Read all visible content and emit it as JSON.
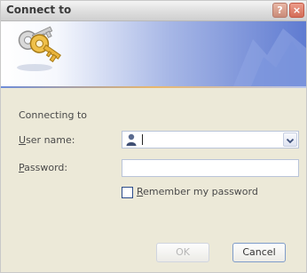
{
  "window": {
    "title": "Connect to",
    "help_label": "?",
    "close_label": "×"
  },
  "banner": {
    "icon": "keys-icon"
  },
  "form": {
    "connecting_label": "Connecting to",
    "user_name": {
      "label_mnemonic": "U",
      "label_rest": "ser name:",
      "value": "",
      "icon": "user-icon"
    },
    "password": {
      "label_mnemonic": "P",
      "label_rest": "assword:",
      "value": ""
    },
    "remember": {
      "label_mnemonic": "R",
      "label_rest": "emember my password",
      "checked": false
    }
  },
  "buttons": {
    "ok": "OK",
    "cancel": "Cancel"
  },
  "colors": {
    "dialog_bg": "#ece9d8",
    "banner_end": "#5f7bd1"
  }
}
